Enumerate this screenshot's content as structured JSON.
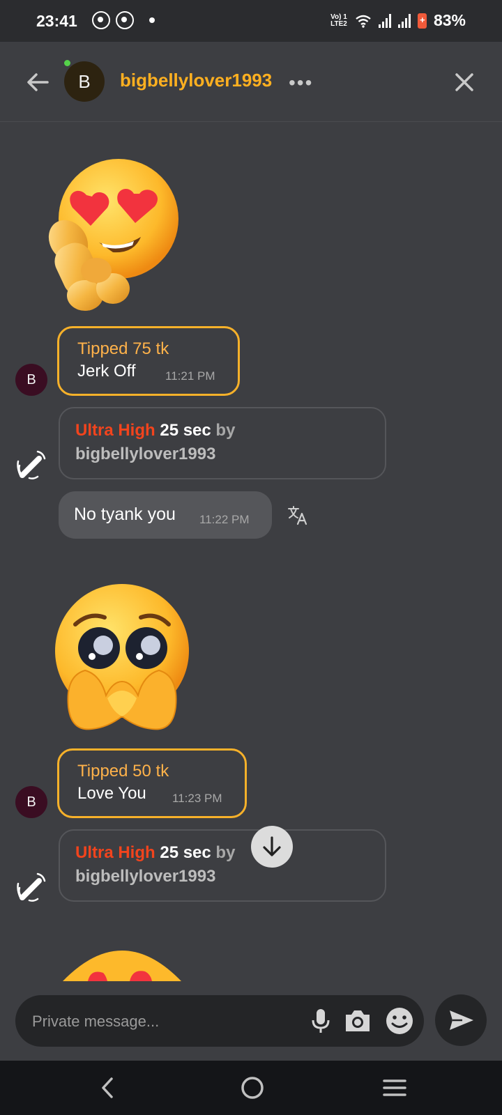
{
  "status_bar": {
    "time": "23:41",
    "network_label": "Vo) 1 LTE2",
    "battery": "83%"
  },
  "header": {
    "avatar_letter": "B",
    "username": "bigbellylover1993",
    "more_label": "•••"
  },
  "messages": [
    {
      "type": "tip",
      "title": "Tipped 75 tk",
      "text": "Jerk Off",
      "time": "11:21 PM",
      "avatar_letter": "B",
      "emoji": "heart-eyes-emoji"
    },
    {
      "type": "ultra",
      "level": "Ultra High",
      "duration": "25 sec",
      "by": "by",
      "user": "bigbellylover1993"
    },
    {
      "type": "text",
      "text": "No tyank you",
      "time": "11:22 PM"
    },
    {
      "type": "tip",
      "title": "Tipped 50 tk",
      "text": "Love You",
      "time": "11:23 PM",
      "avatar_letter": "B",
      "emoji": "pleading-heart-hands-emoji"
    },
    {
      "type": "ultra",
      "level": "Ultra High",
      "duration": "25 sec",
      "by": "by",
      "user": "bigbellylover1993"
    }
  ],
  "composer": {
    "placeholder": "Private message..."
  },
  "colors": {
    "background": "#3d3e42",
    "username": "#ffb020",
    "tip_border": "#f7b12a",
    "ultra_red": "#f2441d"
  }
}
